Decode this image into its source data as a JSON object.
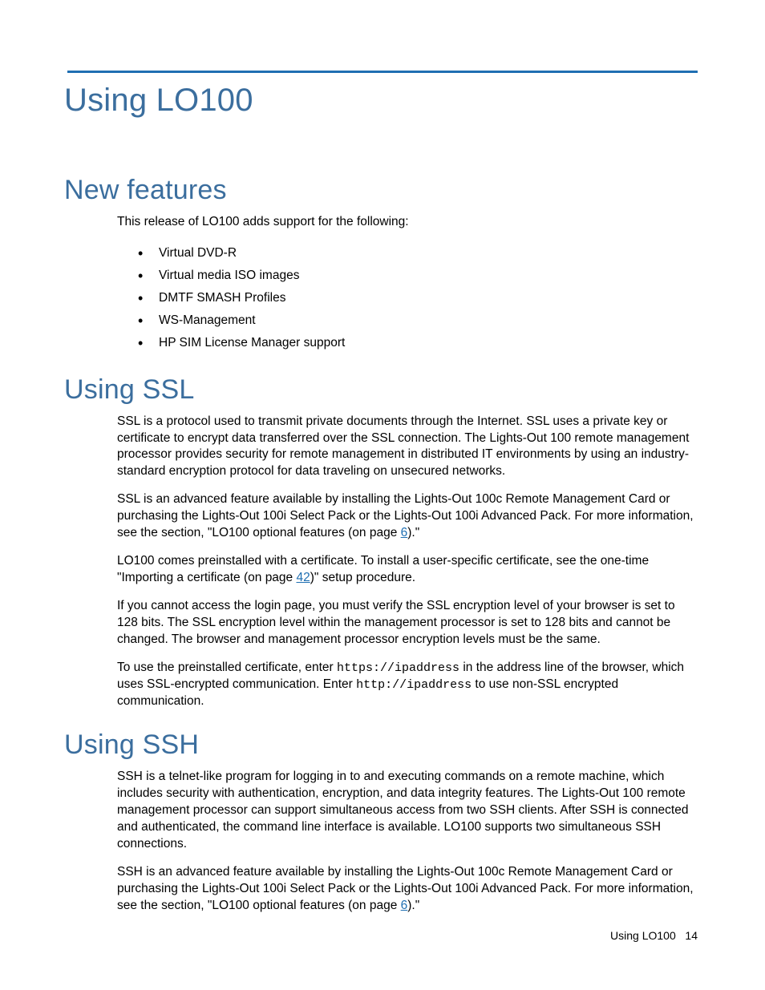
{
  "title": "Using LO100",
  "sections": {
    "new_features": {
      "heading": "New features",
      "intro": "This release of LO100 adds support for the following:",
      "items": [
        "Virtual DVD-R",
        "Virtual media ISO images",
        "DMTF SMASH Profiles",
        "WS-Management",
        "HP SIM License Manager support"
      ]
    },
    "using_ssl": {
      "heading": "Using SSL",
      "p1": "SSL is a protocol used to transmit private documents through the Internet. SSL uses a private key or certificate to encrypt data transferred over the SSL connection. The Lights-Out 100 remote management processor provides security for remote management in distributed IT environments by using an industry-standard encryption protocol for data traveling on unsecured networks.",
      "p2_pre": "SSL is an advanced feature available by installing the Lights-Out 100c Remote Management Card or purchasing the Lights-Out 100i Select Pack or the Lights-Out 100i Advanced Pack. For more information, see the section, \"LO100 optional features (on page ",
      "p2_link": "6",
      "p2_post": ").\"",
      "p3_pre": "LO100 comes preinstalled with a certificate. To install a user-specific certificate, see the one-time \"Importing a certificate (on page ",
      "p3_link": "42",
      "p3_post": ")\" setup procedure.",
      "p4": "If you cannot access the login page, you must verify the SSL encryption level of your browser is set to 128 bits. The SSL encryption level within the management processor is set to 128 bits and cannot be changed. The browser and management processor encryption levels must be the same.",
      "p5_pre": "To use the preinstalled certificate, enter ",
      "p5_code1": "https://ipaddress",
      "p5_mid": " in the address line of the browser, which uses SSL-encrypted communication. Enter ",
      "p5_code2": "http://ipaddress",
      "p5_post": " to use non-SSL encrypted communication."
    },
    "using_ssh": {
      "heading": "Using SSH",
      "p1": "SSH is a telnet-like program for logging in to and executing commands on a remote machine, which includes security with authentication, encryption, and data integrity features. The Lights-Out 100 remote management processor can support simultaneous access from two SSH clients. After SSH is connected and authenticated, the command line interface is available. LO100 supports two simultaneous SSH connections.",
      "p2_pre": "SSH is an advanced feature available by installing the Lights-Out 100c Remote Management Card or purchasing the Lights-Out 100i Select Pack or the Lights-Out 100i Advanced Pack. For more information, see the section, \"LO100 optional features (on page ",
      "p2_link": "6",
      "p2_post": ").\""
    }
  },
  "footer": {
    "label": "Using LO100",
    "page": "14"
  }
}
